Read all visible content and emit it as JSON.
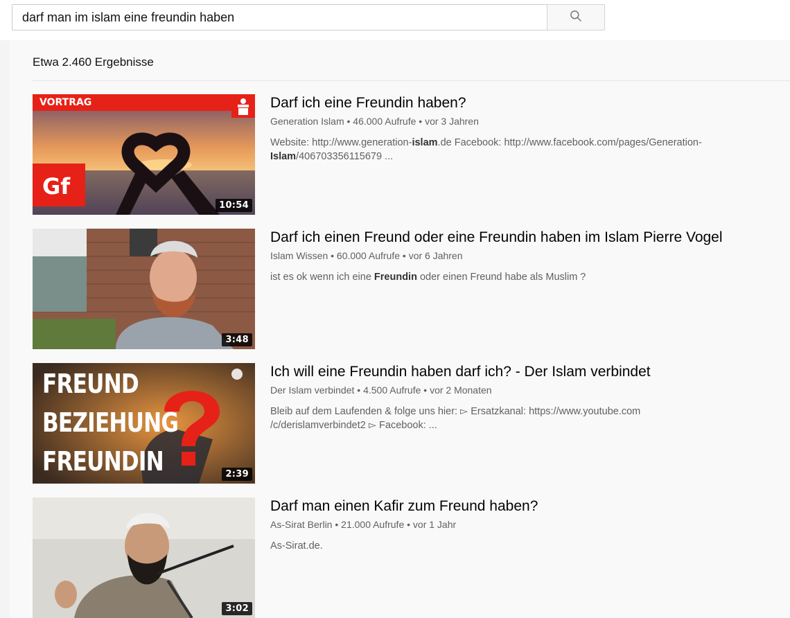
{
  "search": {
    "query": "darf man im islam eine freundin haben",
    "button_icon": "search-icon"
  },
  "results_count": "Etwa 2.460 Ergebnisse",
  "results": [
    {
      "title": "Darf ich eine Freundin haben?",
      "channel": "Generation Islam",
      "views": "46.000 Aufrufe",
      "age": "vor 3 Jahren",
      "desc_parts": [
        "Website: http://www.generation-",
        "islam",
        ".de Facebook: http://www.facebook.com/pages/Generation-",
        "Islam",
        "/406703356115679 ..."
      ],
      "duration": "10:54",
      "thumb_labels": [
        "VORTRAG",
        "Gf"
      ]
    },
    {
      "title": "Darf ich einen Freund oder eine Freundin haben im Islam Pierre Vogel",
      "channel": "Islam Wissen",
      "views": "60.000 Aufrufe",
      "age": "vor 6 Jahren",
      "desc_parts": [
        "ist es ok wenn ich eine ",
        "Freundin",
        " oder einen Freund habe als Muslim ?"
      ],
      "duration": "3:48",
      "thumb_labels": []
    },
    {
      "title": "Ich will eine Freundin haben darf ich? - Der Islam verbindet",
      "channel": "Der Islam verbindet",
      "views": "4.500 Aufrufe",
      "age": "vor 2 Monaten",
      "desc_parts": [
        "Bleib auf dem Laufenden & folge uns hier: ▻ Ersatzkanal: https://www.youtube.com /c/derislamverbindet2 ▻ Facebook: ..."
      ],
      "duration": "2:39",
      "thumb_labels": [
        "FREUND",
        "BEZIEHUNG",
        "FREUNDIN"
      ]
    },
    {
      "title": "Darf man einen Kafir zum Freund haben?",
      "channel": "As-Sirat Berlin",
      "views": "21.000 Aufrufe",
      "age": "vor 1 Jahr",
      "desc_parts": [
        "As-Sirat.de."
      ],
      "duration": "3:02",
      "thumb_labels": []
    }
  ],
  "separator": " • ",
  "colors": {
    "title": "#030303",
    "meta": "#606060",
    "badge_red": "#e62117"
  }
}
